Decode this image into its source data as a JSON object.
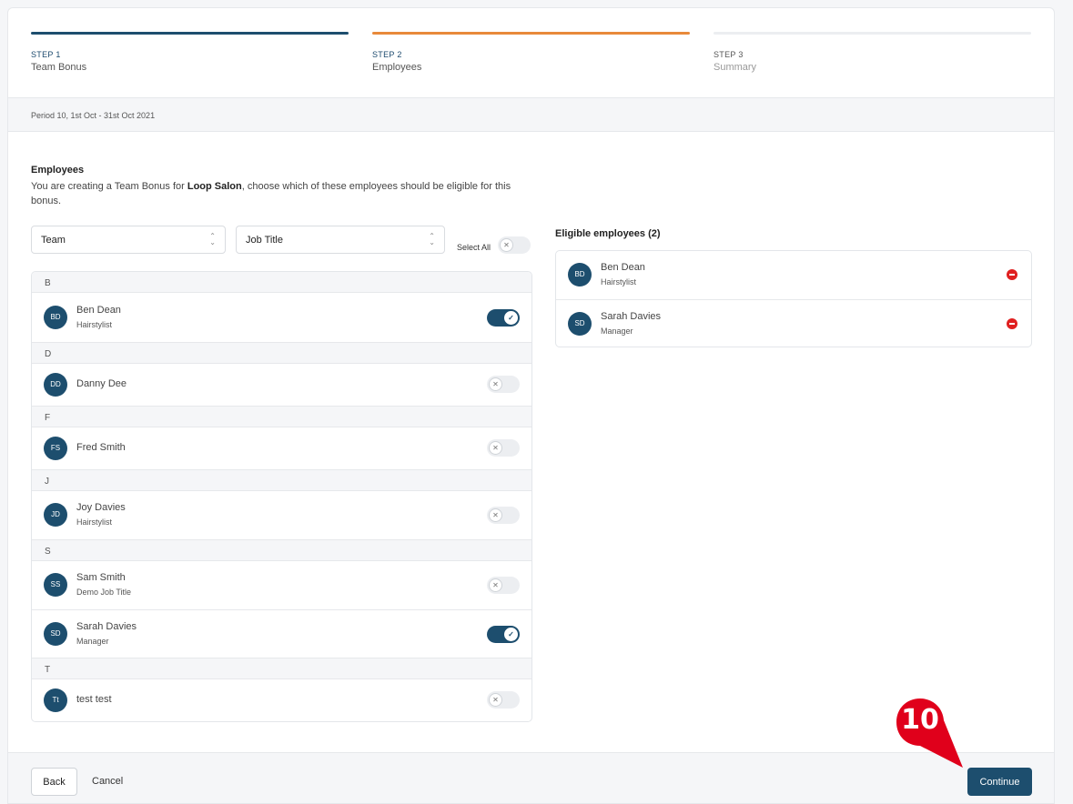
{
  "steps": [
    {
      "num": "STEP 1",
      "name": "Team Bonus"
    },
    {
      "num": "STEP 2",
      "name": "Employees"
    },
    {
      "num": "STEP 3",
      "name": "Summary"
    }
  ],
  "period": "Period 10, 1st Oct - 31st Oct 2021",
  "section": {
    "title": "Employees",
    "desc_before": "You are creating a Team Bonus for ",
    "desc_bold": "Loop Salon",
    "desc_after": ", choose which of these employees should be eligible for this bonus."
  },
  "filters": {
    "team": "Team",
    "job_title": "Job Title",
    "select_all": "Select All"
  },
  "groups": [
    "B",
    "D",
    "F",
    "J",
    "S",
    "T"
  ],
  "employees": [
    {
      "initials": "BD",
      "name": "Ben Dean",
      "title": "Hairstylist",
      "selected": true
    },
    {
      "initials": "DD",
      "name": "Danny Dee",
      "title": "",
      "selected": false
    },
    {
      "initials": "FS",
      "name": "Fred Smith",
      "title": "",
      "selected": false
    },
    {
      "initials": "JD",
      "name": "Joy Davies",
      "title": "Hairstylist",
      "selected": false
    },
    {
      "initials": "SS",
      "name": "Sam Smith",
      "title": "Demo Job Title",
      "selected": false
    },
    {
      "initials": "SD",
      "name": "Sarah Davies",
      "title": "Manager",
      "selected": true
    },
    {
      "initials": "Tt",
      "name": "test test",
      "title": "",
      "selected": false
    }
  ],
  "eligible": {
    "title": "Eligible employees (2)",
    "items": [
      {
        "initials": "BD",
        "name": "Ben Dean",
        "title": "Hairstylist"
      },
      {
        "initials": "SD",
        "name": "Sarah Davies",
        "title": "Manager"
      }
    ]
  },
  "footer": {
    "back": "Back",
    "cancel": "Cancel",
    "continue": "Continue"
  },
  "callout": {
    "number": "10",
    "color": "#e0001b"
  },
  "colors": {
    "primary": "#1d4e6e",
    "active_step": "#e8893a",
    "remove": "#e02020"
  }
}
